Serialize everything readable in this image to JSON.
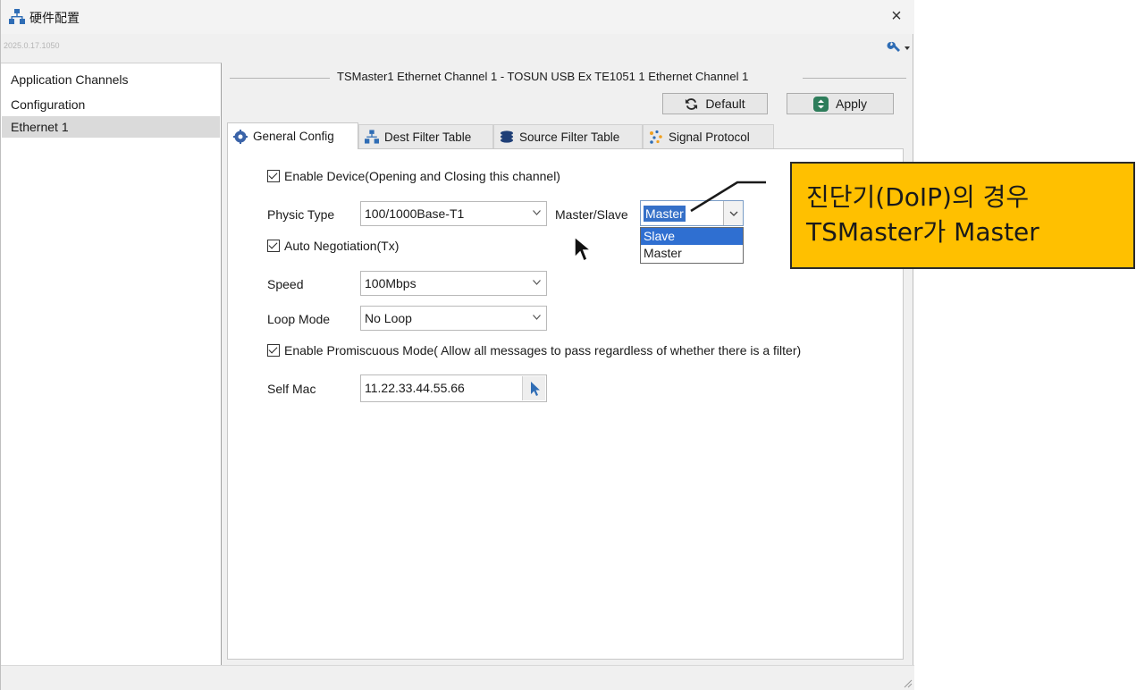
{
  "window": {
    "title": "硬件配置",
    "version": "2025.0.17.1050",
    "close_glyph": "×"
  },
  "sidebar": {
    "items": [
      {
        "label": "Application Channels"
      },
      {
        "label": "Configuration"
      },
      {
        "label": "Ethernet 1",
        "selected": true
      }
    ]
  },
  "channel": {
    "group_title": "TSMaster1 Ethernet Channel 1 - TOSUN USB Ex TE1051 1 Ethernet Channel 1"
  },
  "toolbar": {
    "default_label": "Default",
    "apply_label": "Apply"
  },
  "tabs": [
    {
      "label": "General Config",
      "icon": "gear-icon",
      "active": true
    },
    {
      "label": "Dest Filter Table",
      "icon": "network-icon"
    },
    {
      "label": "Source Filter Table",
      "icon": "stack-icon"
    },
    {
      "label": "Signal Protocol",
      "icon": "dots-icon"
    }
  ],
  "general": {
    "enable_device": {
      "label": "Enable Device(Opening and Closing this channel)",
      "checked": true
    },
    "physic_type": {
      "label": "Physic Type",
      "value": "100/1000Base-T1"
    },
    "master_slave": {
      "label": "Master/Slave",
      "value": "Master",
      "options": [
        "Slave",
        "Master"
      ],
      "highlighted": "Slave"
    },
    "auto_negotiation": {
      "label": "Auto Negotiation(Tx)",
      "checked": true
    },
    "speed": {
      "label": "Speed",
      "value": "100Mbps"
    },
    "loop_mode": {
      "label": "Loop Mode",
      "value": "No Loop"
    },
    "promiscuous": {
      "label": "Enable Promiscuous Mode( Allow all messages to pass regardless of whether there is a filter)",
      "checked": true
    },
    "self_mac": {
      "label": "Self Mac",
      "value": "11.22.33.44.55.66"
    }
  },
  "callout": {
    "line1": "진단기(DoIP)의 경우",
    "line2": "TSMaster가 Master",
    "color": "#ffc000"
  },
  "colors": {
    "selection": "#3570c8",
    "apply_icon": "#2e7d5b",
    "default_icon": "#2a2a2a"
  }
}
